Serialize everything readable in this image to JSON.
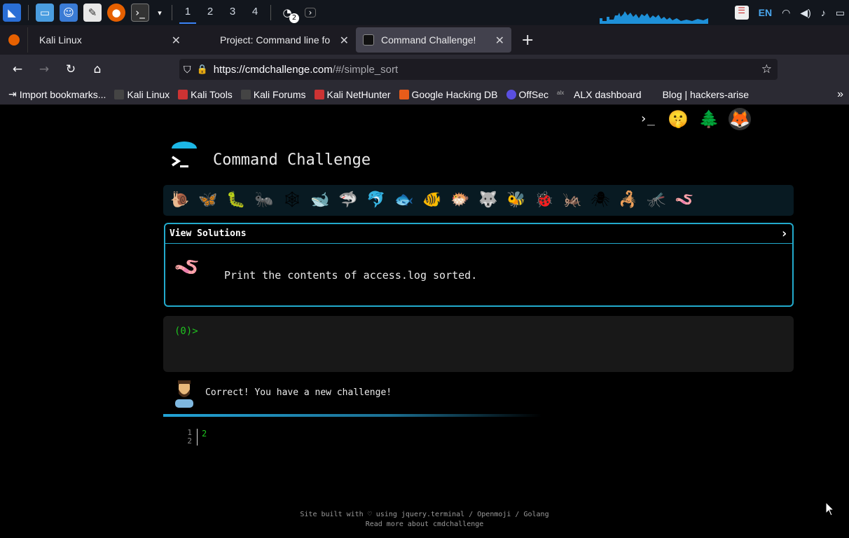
{
  "taskbar": {
    "workspaces": [
      "1",
      "2",
      "3",
      "4"
    ],
    "active_workspace": "1",
    "badge_count": "2",
    "language": "EN"
  },
  "tabs": [
    {
      "title": "Kali Linux",
      "active": false
    },
    {
      "title": "Project: Command line fo",
      "active": false
    },
    {
      "title": "Command Challenge!",
      "active": true
    }
  ],
  "url": {
    "host": "https://cmdchallenge.com",
    "path": "/#/simple_sort"
  },
  "bookmarks": [
    "Import bookmarks...",
    "Kali Linux",
    "Kali Tools",
    "Kali Forums",
    "Kali NetHunter",
    "Google Hacking DB",
    "OffSec",
    "ALX dashboard",
    "Blog | hackers-arise"
  ],
  "page": {
    "title": "Command Challenge",
    "animals": [
      "🐌",
      "🦋",
      "🐛",
      "🐜",
      "🕸",
      "🐋",
      "🦈",
      "🐬",
      "🐟",
      "🐠",
      "🐡",
      "🐺",
      "🐝",
      "🐞",
      "🦗",
      "🕷",
      "🦂",
      "🦟",
      "🪱"
    ],
    "view_solutions": "View Solutions",
    "chevron": "›",
    "challenge_icon": "🪱",
    "task": "Print the contents of access.log sorted.",
    "prompt": "(0)>",
    "correct_message": "Correct! You have a new challenge!",
    "line_numbers": [
      "1",
      "2"
    ],
    "output": "2",
    "footer_line1": "Site built with ♡ using jquery.terminal / Openmoji / Golang",
    "footer_line2": "Read more about cmdchallenge"
  }
}
